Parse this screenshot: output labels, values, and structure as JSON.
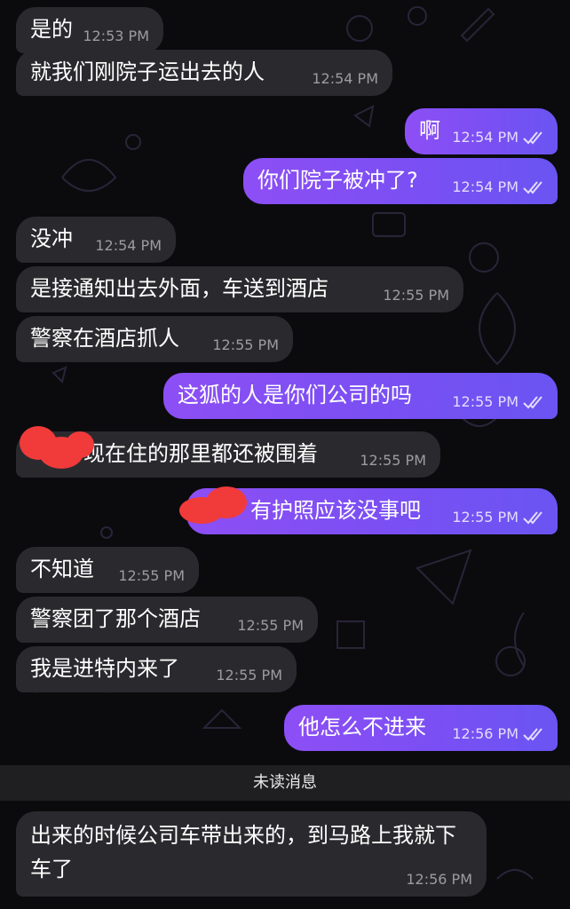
{
  "unread_label": "未读消息",
  "messages": [
    {
      "side": "in",
      "text": "是的",
      "time": "12:53 PM"
    },
    {
      "side": "in",
      "text": "就我们刚院子运出去的人",
      "time": "12:54 PM"
    },
    {
      "side": "out",
      "text": "啊",
      "time": "12:54 PM",
      "read": true
    },
    {
      "side": "out",
      "text": "你们院子被冲了?",
      "time": "12:54 PM",
      "read": true
    },
    {
      "side": "in",
      "text": "没冲",
      "time": "12:54 PM"
    },
    {
      "side": "in",
      "text": "是接通知出去外面，车送到酒店",
      "time": "12:55 PM"
    },
    {
      "side": "in",
      "text": "警察在酒店抓人",
      "time": "12:55 PM"
    },
    {
      "side": "out",
      "text": "这狐的人是你们公司的吗",
      "time": "12:55 PM",
      "read": true
    },
    {
      "side": "in",
      "text": "现在住的那里都还被围着",
      "time": "12:55 PM"
    },
    {
      "side": "out",
      "text": "有护照应该没事吧",
      "time": "12:55 PM",
      "read": true
    },
    {
      "side": "in",
      "text": "不知道",
      "time": "12:55 PM"
    },
    {
      "side": "in",
      "text": "警察团了那个酒店",
      "time": "12:55 PM"
    },
    {
      "side": "in",
      "text": "我是进特内来了",
      "time": "12:55 PM"
    },
    {
      "side": "out",
      "text": "他怎么不进来",
      "time": "12:56 PM",
      "read": true
    },
    {
      "side": "in",
      "text": "出来的时候公司车带出来的，到马路上我就下车了",
      "time": "12:56 PM"
    }
  ],
  "colors": {
    "background": "#0b0b0e",
    "incoming_bubble": "#2a2a2e",
    "outgoing_start": "#8d4ff5",
    "outgoing_end": "#6a55f2",
    "redaction": "#f13a3a"
  }
}
